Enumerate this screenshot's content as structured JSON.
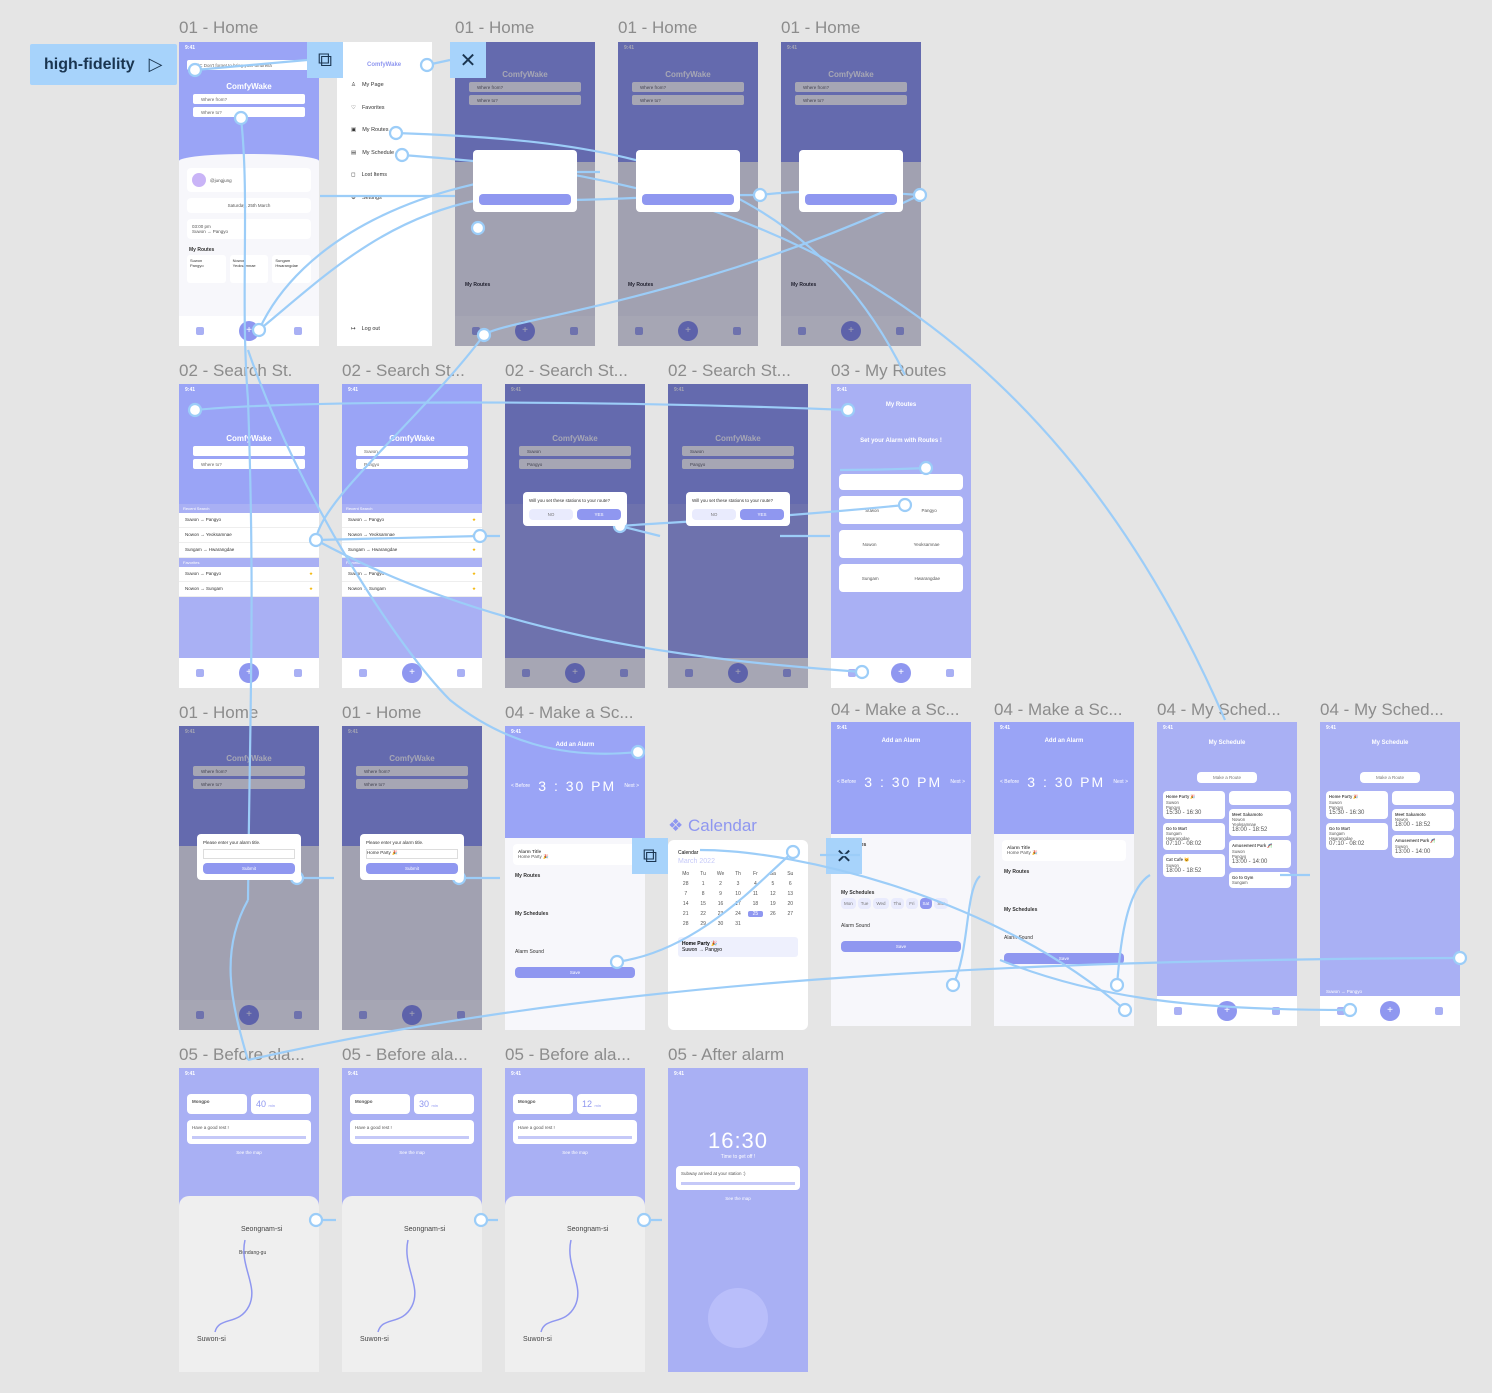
{
  "flow": {
    "label": "high-fidelity"
  },
  "titles": {
    "home": "01 - Home",
    "search": "02 - Search St...",
    "search_0": "02 - Search St.",
    "my_routes": "03 - My Routes",
    "make": "04 - Make a Sc...",
    "my_sched": "04 - My Sched...",
    "before": "05 - Before ala...",
    "after": "05 - After alarm",
    "calendar": "Calendar"
  },
  "common": {
    "time": "9:41",
    "brand": "ComfyWake",
    "where_from": "Where from?",
    "where_to": "Where to?",
    "weather": "6°C  Don't forget to bring your umbrella",
    "user": "@jungjung",
    "date_line": "Saturday, 25th March",
    "trip_time": "03:00 pm",
    "trip_route": "Suwon → Pangyo",
    "my_routes": "My Routes",
    "route_a": "Suwon",
    "route_b": "Pangyo",
    "route_c": "Nowon",
    "route_d": "Yeoksamnae",
    "route_e": "Sungam",
    "route_f": "Hwarangdae",
    "suwon": "Suwon",
    "pangyo": "Pangyo"
  },
  "menu": {
    "brand": "ComfyWake",
    "items": [
      "My Page",
      "Favorites",
      "My Routes",
      "My Schedule",
      "Lost Items",
      "Settings"
    ],
    "logout": "Log out"
  },
  "search": {
    "recent_title": "Recent Search",
    "favs_title": "Favorites",
    "recent": [
      "Suwon → Pangyo",
      "Nowon → Yeoksamnae",
      "Sungam → Hwarangdae"
    ],
    "favs": [
      "Suwon → Pangyo",
      "Nowon → Sungam"
    ],
    "dialog": "Will you set these stations to your route?",
    "no": "NO",
    "yes": "YES"
  },
  "my_routes": {
    "title": "My Routes",
    "headline": "Set your Alarm with Routes !",
    "r1": [
      "Suwon",
      "Pangyo"
    ],
    "r2": [
      "Nowon",
      "Yeoksamnae"
    ],
    "r3": [
      "Sungam",
      "Hwarangdae"
    ]
  },
  "alarm_modal": {
    "prompt": "Please enter your alarm title.",
    "value": "Home Party 🎉",
    "submit": "Submit"
  },
  "make": {
    "title": "Add an Alarm",
    "before": "< Before",
    "next": "Next >",
    "time": "3 : 30  PM",
    "alarm_title": "Alarm Title",
    "title_value": "Home Party 🎉",
    "my_routes": "My Routes",
    "my_schedules": "My Schedules",
    "alarm_sound": "Alarm Sound",
    "save": "Save",
    "days": [
      "Mon",
      "Tue",
      "Wed",
      "Thu",
      "Fri",
      "Sat",
      "Sun"
    ]
  },
  "calendar": {
    "heading": "Calendar",
    "month": "March 2022",
    "weekdays": [
      "Mo",
      "Tu",
      "We",
      "Th",
      "Fr",
      "Sa",
      "Su"
    ],
    "days": [
      "28",
      "1",
      "2",
      "3",
      "4",
      "5",
      "6",
      "7",
      "8",
      "9",
      "10",
      "11",
      "12",
      "13",
      "14",
      "15",
      "16",
      "17",
      "18",
      "19",
      "20",
      "21",
      "22",
      "23",
      "24",
      "25",
      "26",
      "27",
      "28",
      "29",
      "30",
      "31",
      "",
      "",
      ""
    ],
    "selected": "25",
    "event_day": "25",
    "event": "Home Party 🎉",
    "event_route": "Suwon → Pangyo"
  },
  "my_sched": {
    "title": "My Schedule",
    "make_route": "Make a Route",
    "cards_a": [
      {
        "name": "Home Party 🎉",
        "from": "Suwon",
        "to": "Pangyo",
        "time": "15:30 - 16:30"
      },
      {
        "name": "Go to Mart",
        "from": "Sungam",
        "to": "Hwarangdae",
        "time": "07:10 - 08:02"
      },
      {
        "name": "Cat Cafe 😺",
        "from": "Suwon",
        "to": "Pangyo",
        "time": "18:00 - 18:52"
      }
    ],
    "cards_b": [
      {
        "name": "Meet Sakamoto",
        "from": "Nowon",
        "to": "Yeoksamnae",
        "time": "18:00 - 18:52"
      },
      {
        "name": "Amusement Park 🎢",
        "from": "Suwon",
        "to": "Pangyo",
        "time": "13:00 - 14:00"
      },
      {
        "name": "Go to Gym",
        "from": "Sungam",
        "to": "",
        "time": ""
      }
    ],
    "bar_route": "Suwon → Pangyo"
  },
  "before": {
    "dest": "Mongpo",
    "mins": [
      "40",
      "30",
      "12"
    ],
    "unit": "min",
    "good": "Have a good rest !",
    "see_map": "See the map",
    "cities": {
      "a": "Seongnam-si",
      "b": "Suwon-si",
      "c": "Bundang-gu",
      "d": "Yo",
      "e": "si"
    }
  },
  "after": {
    "time": "16:30",
    "sub": "Time to get off !",
    "msg": "Subway arrived at your station :)",
    "see_map": "See the map"
  },
  "colors": {
    "accent": "#8f97f0",
    "hero": "#9aa4f6",
    "link": "#9ccdf8",
    "canvas": "#e5e5e5"
  }
}
